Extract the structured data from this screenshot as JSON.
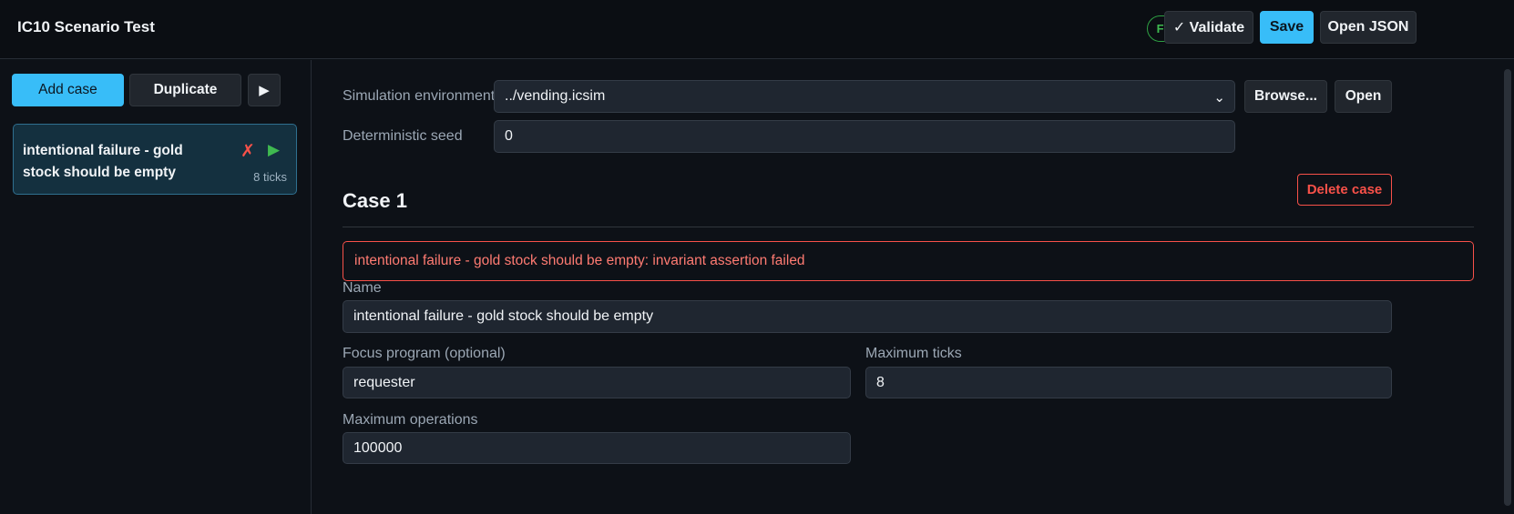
{
  "header": {
    "title": "IC10 Scenario Test",
    "status_badge": "Form valid",
    "validate_label": "✓ Validate",
    "save_label": "Save",
    "open_json_label": "Open JSON"
  },
  "sidebar": {
    "add_case_label": "Add case",
    "duplicate_label": "Duplicate",
    "run_all_icon": "play-icon",
    "cases": [
      {
        "name": "intentional failure - gold stock should be empty",
        "status_icon": "✗",
        "run_icon": "▶",
        "ticks": "8 ticks"
      }
    ]
  },
  "scenario": {
    "sim_env_label": "Simulation environment",
    "sim_env_value": "../vending.icsim",
    "browse_label": "Browse...",
    "open_label": "Open",
    "seed_label": "Deterministic seed",
    "seed_value": "0"
  },
  "case": {
    "heading": "Case 1",
    "delete_label": "Delete case",
    "error_message": "intentional failure - gold stock should be empty: invariant assertion failed",
    "name_label": "Name",
    "name_value": "intentional failure - gold stock should be empty",
    "focus_label": "Focus program (optional)",
    "focus_value": "requester",
    "max_ticks_label": "Maximum ticks",
    "max_ticks_value": "8",
    "max_ops_label": "Maximum operations",
    "max_ops_value": "100000"
  },
  "colors": {
    "accent": "#38bdf8",
    "danger": "#f85149",
    "success": "#3fb950",
    "background": "#0d1117"
  }
}
